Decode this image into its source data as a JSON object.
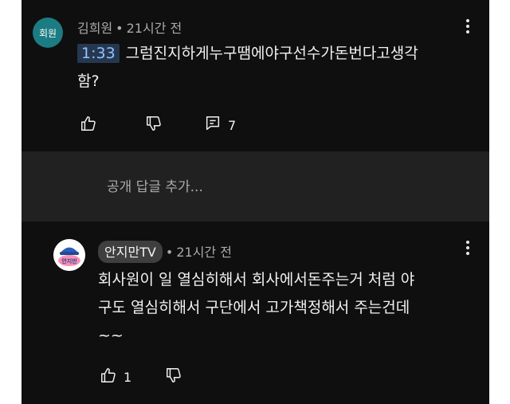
{
  "comment_top": {
    "avatar_text": "회원",
    "author": "김희원",
    "separator": "•",
    "time": "21시간 전",
    "timestamp": "1:33",
    "text_line1": "그럼진지하게누구땜에야구선수가돈번다고생각",
    "text_line2": "함?",
    "like_icon": "thumb-up-icon",
    "dislike_icon": "thumb-down-icon",
    "reply_icon": "reply-comment-icon",
    "reply_count": "7"
  },
  "reply_box": {
    "placeholder": "공개 답글 추가..."
  },
  "comment_reply": {
    "avatar_text": "안지만",
    "author": "안지만TV",
    "separator": "•",
    "time": "21시간 전",
    "text_line1": "회사원이 일 열심히해서 회사에서돈주는거 처럼 야",
    "text_line2": "구도 열심히해서 구단에서 고가책정해서 주는건데",
    "text_line3": "~~",
    "like_icon": "thumb-up-icon",
    "like_count": "1",
    "dislike_icon": "thumb-down-icon"
  },
  "colors": {
    "background": "#0f0f0f",
    "reply_area": "#212121",
    "timestamp_bg": "#263850",
    "timestamp_text": "#8fc3ff",
    "author_pill": "#3f3f3f"
  }
}
